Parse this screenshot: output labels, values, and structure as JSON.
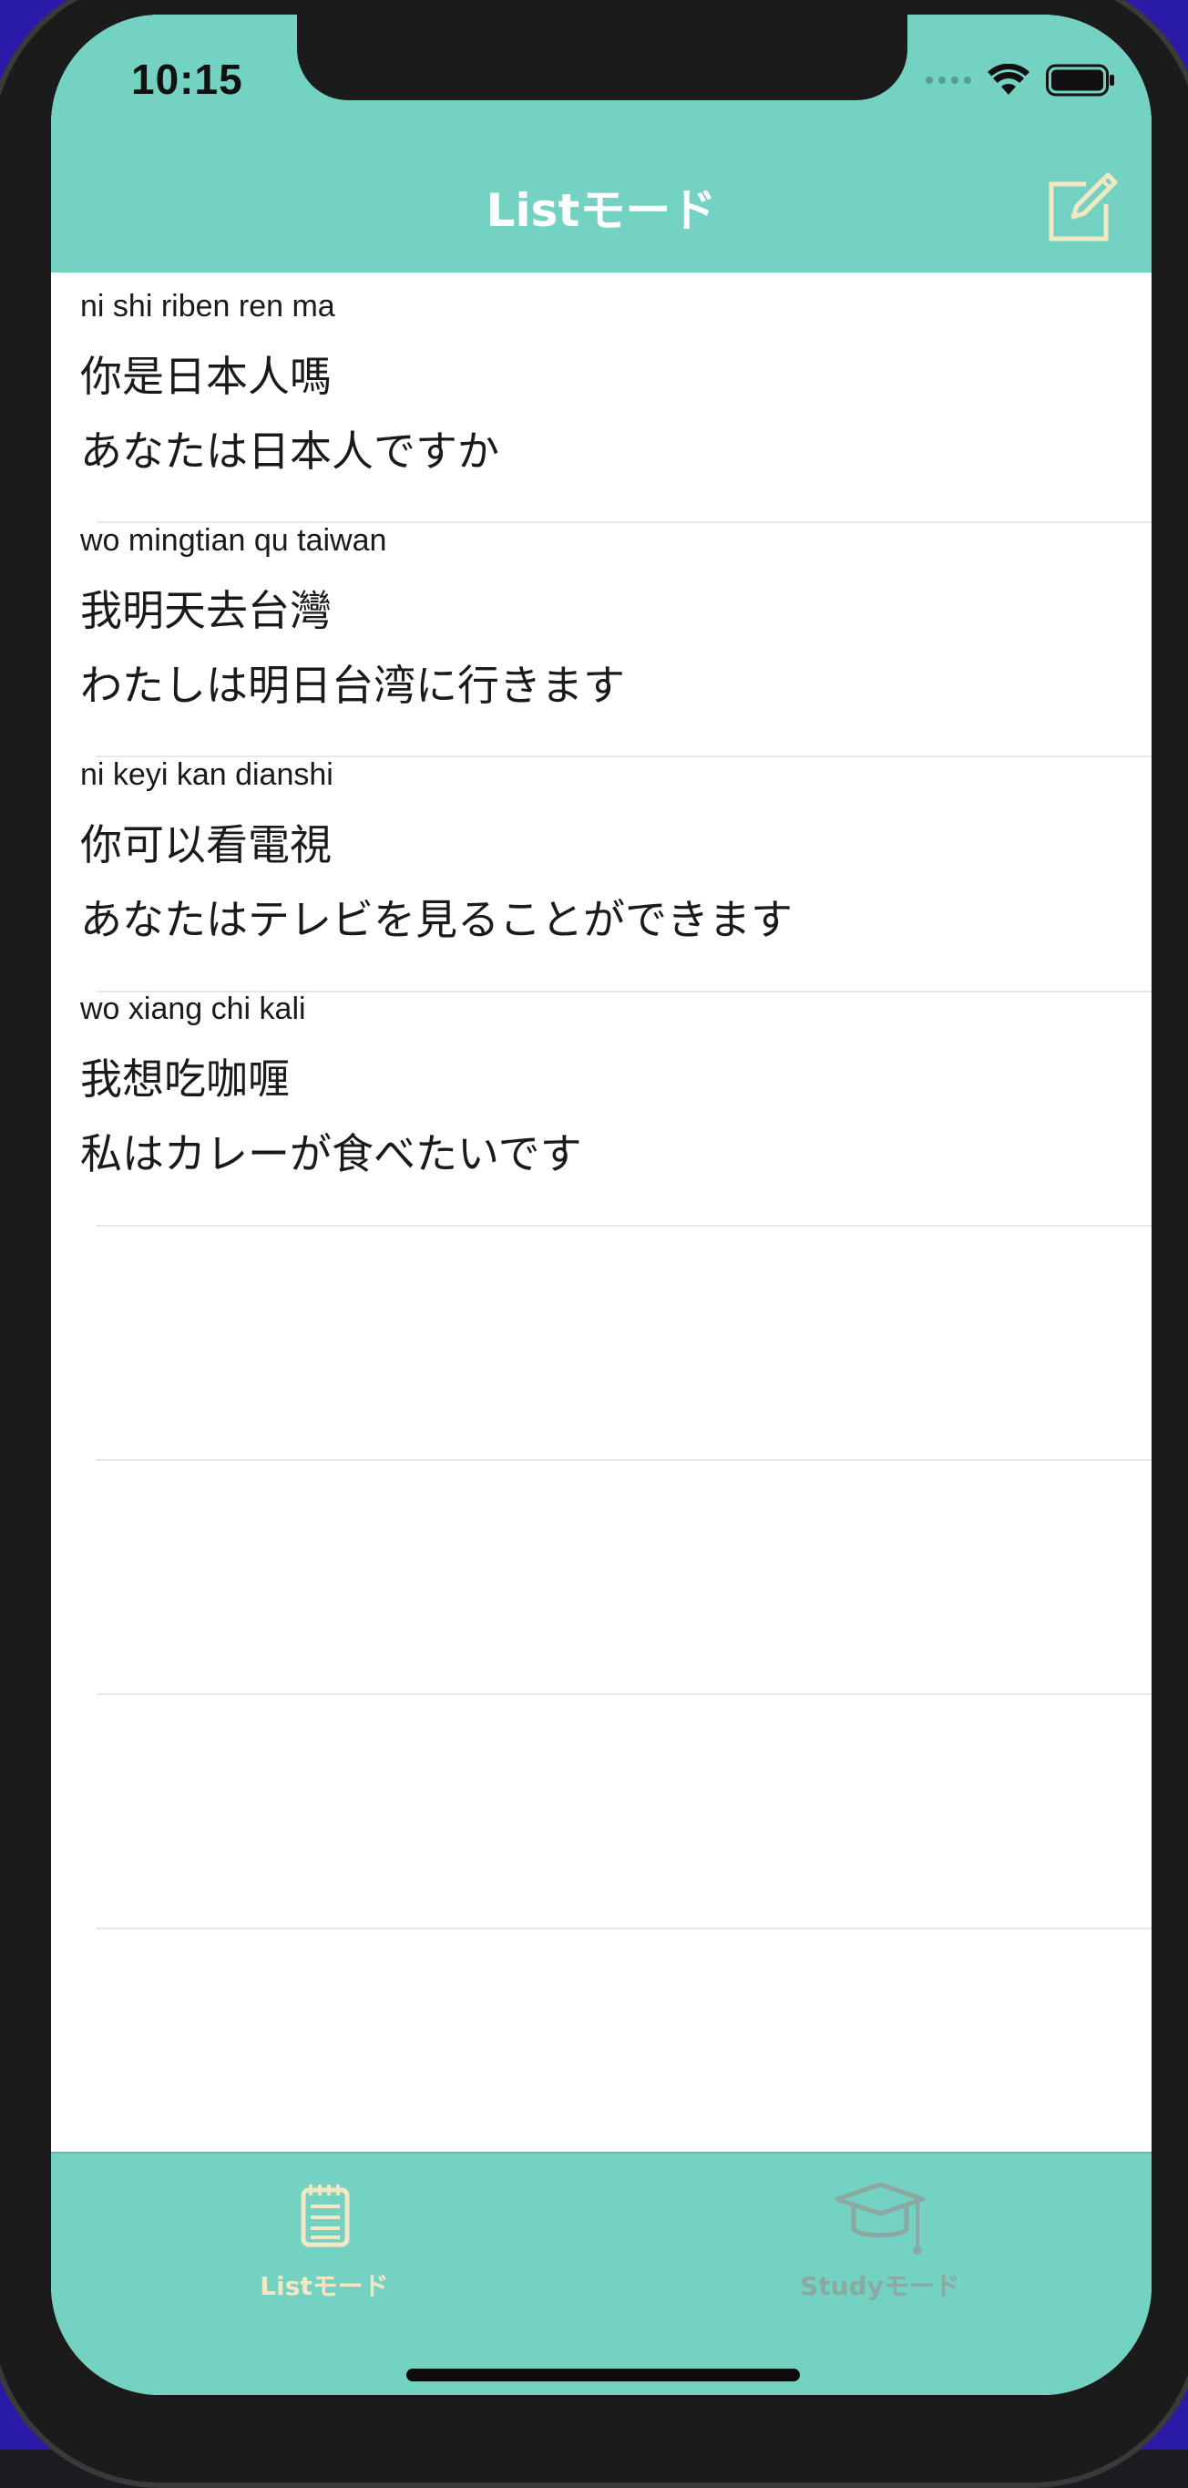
{
  "status_bar": {
    "time": "10:15"
  },
  "nav": {
    "title": "Listモード",
    "compose_icon": "compose-icon"
  },
  "list": {
    "items": [
      {
        "pinyin": "ni shi riben ren ma",
        "chinese": "你是日本人嗎",
        "japanese": "あなたは日本人ですか"
      },
      {
        "pinyin": "wo mingtian qu taiwan",
        "chinese": "我明天去台灣",
        "japanese": "わたしは明日台湾に行きます"
      },
      {
        "pinyin": "ni keyi kan dianshi",
        "chinese": "你可以看電視",
        "japanese": "あなたはテレビを見ることができます"
      },
      {
        "pinyin": "wo xiang chi kali",
        "chinese": "我想吃咖喱",
        "japanese": "私はカレーが食べたいです"
      }
    ]
  },
  "tabbar": {
    "tabs": [
      {
        "label": "Listモード",
        "icon": "notepad-icon",
        "selected": true
      },
      {
        "label": "Studyモード",
        "icon": "graduation-cap-icon",
        "selected": false
      }
    ]
  },
  "colors": {
    "accent": "#74d2c2",
    "selected_tab": "#f3e7c4",
    "unselected_tab": "#8aa9a2"
  }
}
